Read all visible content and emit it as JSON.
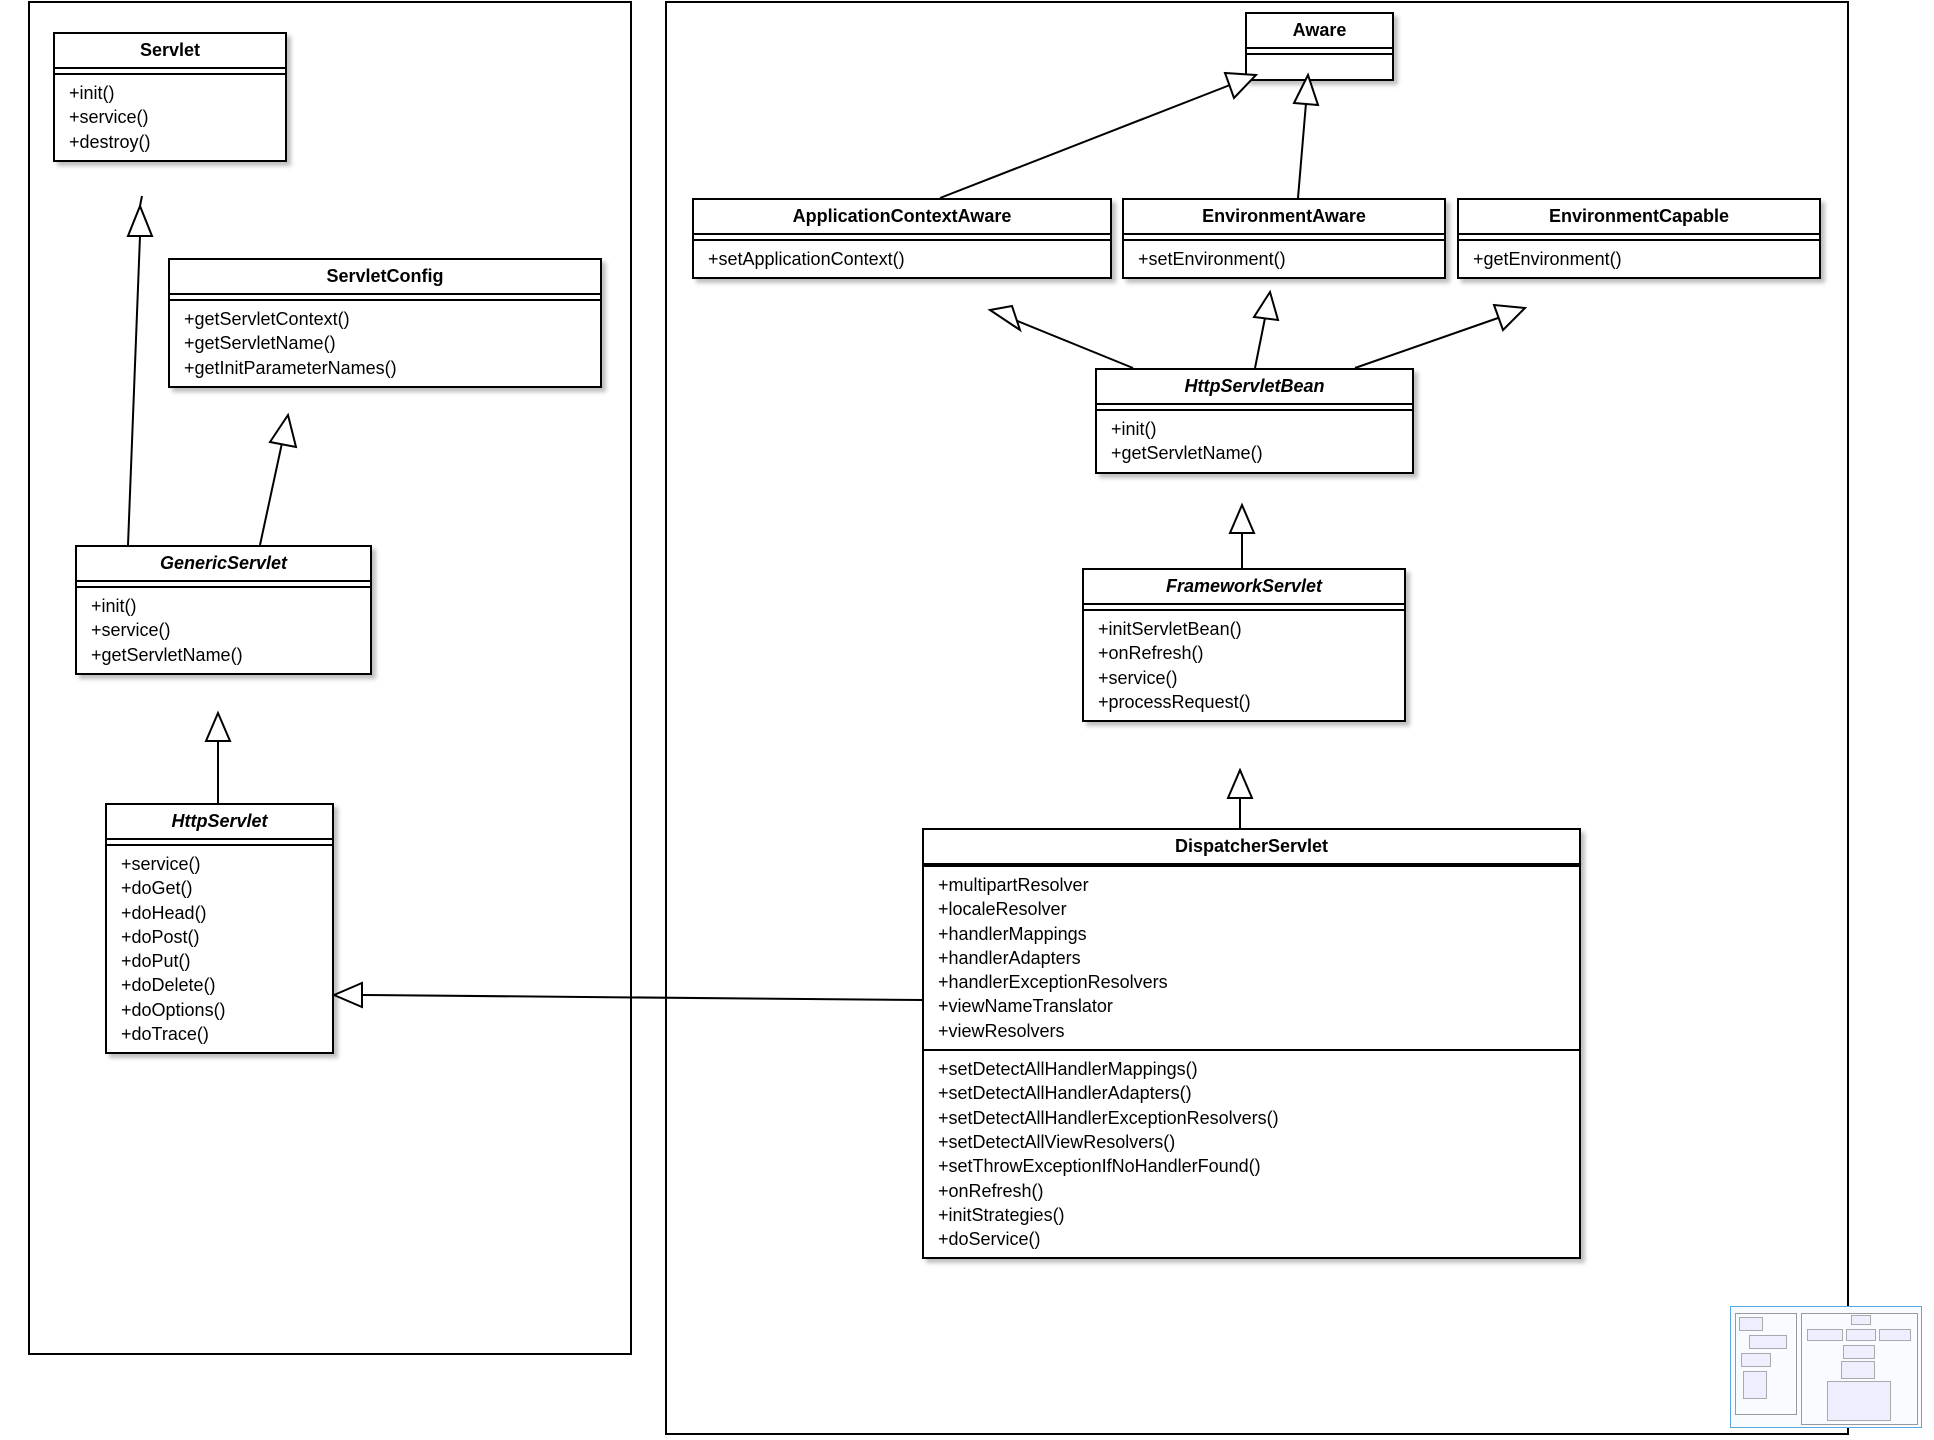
{
  "classes": {
    "servlet": {
      "name": "Servlet",
      "methods": [
        "+init()",
        "+service()",
        "+destroy()"
      ]
    },
    "servletConfig": {
      "name": "ServletConfig",
      "methods": [
        "+getServletContext()",
        "+getServletName()",
        "+getInitParameterNames()"
      ]
    },
    "genericServlet": {
      "name": "GenericServlet",
      "italic": true,
      "methods": [
        "+init()",
        "+service()",
        "+getServletName()"
      ]
    },
    "httpServlet": {
      "name": "HttpServlet",
      "italic": true,
      "methods": [
        "+service()",
        "+doGet()",
        "+doHead()",
        "+doPost()",
        "+doPut()",
        "+doDelete()",
        "+doOptions()",
        "+doTrace()"
      ]
    },
    "aware": {
      "name": "Aware",
      "methods": []
    },
    "appCtxAware": {
      "name": "ApplicationContextAware",
      "methods": [
        "+setApplicationContext()"
      ]
    },
    "envAware": {
      "name": "EnvironmentAware",
      "methods": [
        "+setEnvironment()"
      ]
    },
    "envCapable": {
      "name": "EnvironmentCapable",
      "methods": [
        "+getEnvironment()"
      ]
    },
    "httpServletBean": {
      "name": "HttpServletBean",
      "italic": true,
      "methods": [
        "+init()",
        "+getServletName()"
      ]
    },
    "frameworkServlet": {
      "name": "FrameworkServlet",
      "italic": true,
      "methods": [
        "+initServletBean()",
        "+onRefresh()",
        "+service()",
        "+processRequest()"
      ]
    },
    "dispatcherServlet": {
      "name": "DispatcherServlet",
      "attributes": [
        "+multipartResolver",
        "+localeResolver",
        "+handlerMappings",
        "+handlerAdapters",
        "+handlerExceptionResolvers",
        "+viewNameTranslator",
        "+viewResolvers"
      ],
      "methods": [
        "+setDetectAllHandlerMappings()",
        "+setDetectAllHandlerAdapters()",
        "+setDetectAllHandlerExceptionResolvers()",
        "+setDetectAllViewResolvers()",
        "+setThrowExceptionIfNoHandlerFound()",
        "+onRefresh()",
        "+initStrategies()",
        "+doService()"
      ]
    }
  }
}
